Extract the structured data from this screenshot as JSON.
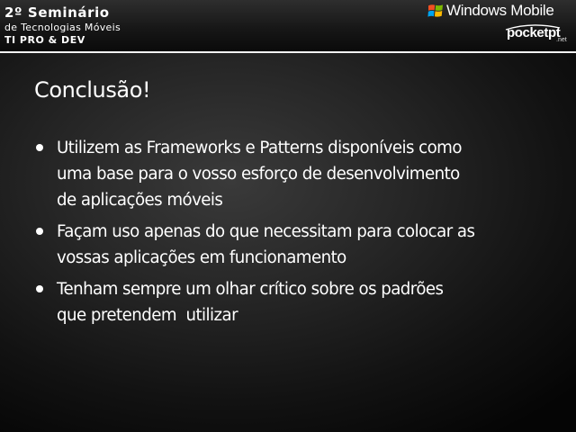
{
  "header": {
    "event_title": "2º Seminário",
    "event_subtitle": "de Tecnologias Móveis",
    "event_track": "TI PRO & DEV",
    "logos": {
      "windows_mobile": {
        "text": "Windows Mobile",
        "icon": "windows-flag-icon",
        "flag_colors": [
          "#f25022",
          "#7fba00",
          "#00a4ef",
          "#ffb900"
        ]
      },
      "pocketpt": {
        "text": "pocketpt",
        "suffix": ".net"
      }
    }
  },
  "slide": {
    "title": "Conclusão!",
    "bullets": [
      {
        "lines": [
          "Utilizem as Frameworks e Patterns disponíveis como",
          "uma base para o vosso esforço de desenvolvimento",
          "de aplicações móveis"
        ]
      },
      {
        "lines": [
          "Façam uso apenas do que necessitam para colocar as",
          "vossas aplicações em funcionamento"
        ]
      },
      {
        "lines": [
          "Tenham sempre um olhar crítico sobre os padrões",
          "que pretendem  utilizar"
        ]
      }
    ]
  },
  "colors": {
    "text": "#ffffff",
    "header_rule": "#f2f2f2",
    "background": "#262626"
  }
}
